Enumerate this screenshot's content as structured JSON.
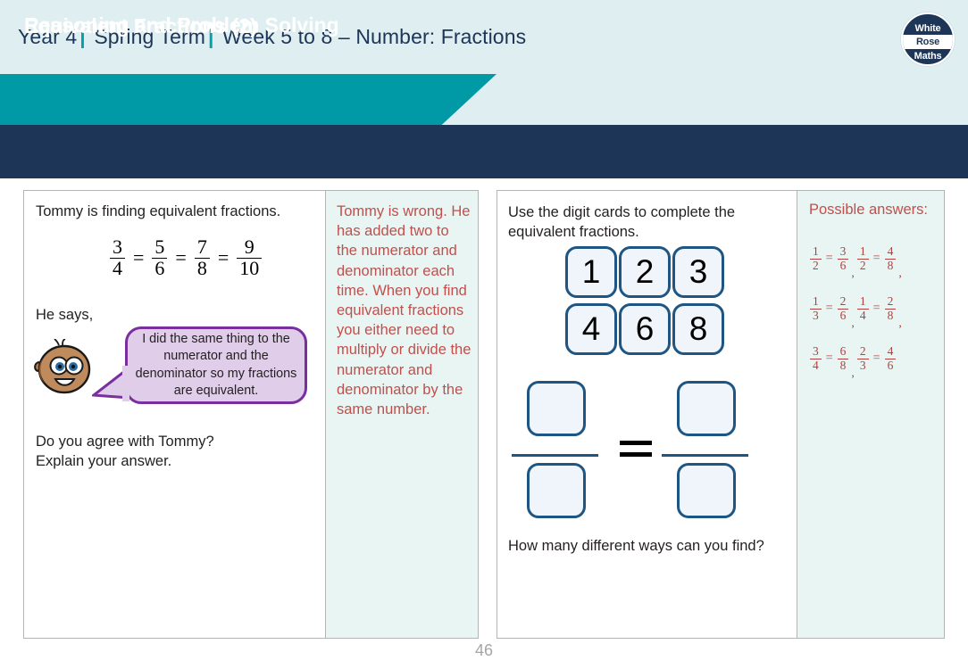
{
  "header": {
    "year": "Year 4",
    "term": "Spring Term",
    "week": "Week 5 to 8 – Number: Fractions",
    "separator": "|",
    "logo": {
      "line1": "White",
      "line2": "Rose",
      "line3": "Maths"
    },
    "topic_banner": "Equivalent Fractions (2)",
    "section_banner": "Reasoning and Problem Solving",
    "colors": {
      "band_bg": "#dfeef0",
      "teal": "#009aa6",
      "navy": "#1d3557",
      "answer_red": "#c0504d",
      "answer_bg": "#e8f5f3",
      "card_border": "#1f5582",
      "card_fill": "#eff5fa",
      "bubble_fill": "#e0cdea",
      "bubble_border": "#7a2f9e"
    }
  },
  "question1": {
    "lead": "Tommy is finding equivalent fractions.",
    "equation": {
      "fractions": [
        {
          "num": "3",
          "den": "4"
        },
        {
          "num": "5",
          "den": "6"
        },
        {
          "num": "7",
          "den": "8"
        },
        {
          "num": "9",
          "den": "10"
        }
      ],
      "operator": "="
    },
    "he_says": "He says,",
    "speech": "I did the same thing to the numerator and the denominator so my fractions are equivalent.",
    "ask_line1": "Do you agree with Tommy?",
    "ask_line2": "Explain your answer."
  },
  "answer1": {
    "text": "Tommy is wrong. He has added two to the numerator and denominator each time. When you find equivalent fractions you either need to multiply or divide the numerator and denominator by the same number."
  },
  "question2": {
    "lead": "Use the digit cards to complete the equivalent fractions.",
    "digit_cards": [
      "1",
      "2",
      "3",
      "4",
      "6",
      "8"
    ],
    "blank_equation_operator": "=",
    "footer": "How many different ways can you find?"
  },
  "answer2": {
    "title": "Possible answers:",
    "rows": [
      {
        "pairs": [
          {
            "left": {
              "num": "1",
              "den": "2"
            },
            "right": {
              "num": "3",
              "den": "6"
            }
          },
          {
            "left": {
              "num": "1",
              "den": "2"
            },
            "right": {
              "num": "4",
              "den": "8"
            }
          }
        ],
        "trailing": ","
      },
      {
        "pairs": [
          {
            "left": {
              "num": "1",
              "den": "3"
            },
            "right": {
              "num": "2",
              "den": "6"
            }
          },
          {
            "left": {
              "num": "1",
              "den": "4"
            },
            "right": {
              "num": "2",
              "den": "8"
            }
          }
        ],
        "trailing": ","
      },
      {
        "pairs": [
          {
            "left": {
              "num": "3",
              "den": "4"
            },
            "right": {
              "num": "6",
              "den": "8"
            }
          },
          {
            "left": {
              "num": "2",
              "den": "3"
            },
            "right": {
              "num": "4",
              "den": "6"
            }
          }
        ],
        "trailing": ""
      }
    ],
    "separator": ",",
    "operator": "="
  },
  "footer": {
    "page_number": "46"
  }
}
